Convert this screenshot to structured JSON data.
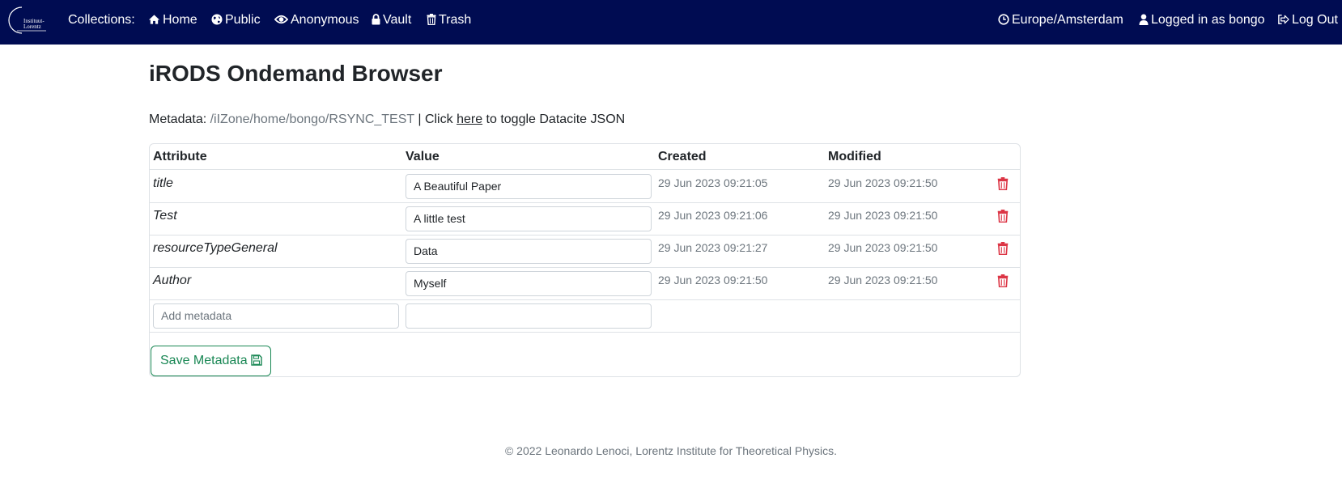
{
  "navbar": {
    "logo_text_line1": "Instituut-",
    "logo_text_line2": "Lorentz",
    "collections_label": "Collections:",
    "links": {
      "home": "Home",
      "public": "Public",
      "anonymous": "Anonymous",
      "vault": "Vault",
      "trash": "Trash"
    },
    "timezone": "Europe/Amsterdam",
    "user": "Logged in as bongo",
    "logout": "Log Out",
    "icons": {
      "home": "home-icon",
      "public": "globe-icon",
      "anonymous": "eye-icon",
      "vault": "lock-icon",
      "trash": "trash-icon",
      "timezone": "clock-icon",
      "user": "user-icon",
      "logout": "sign-out-icon"
    }
  },
  "main": {
    "title": "iRODS Ondemand Browser",
    "metadata_prefix": "Metadata:",
    "path": "/iIZone/home/bongo/RSYNC_TEST",
    "toggle_before": "| Click",
    "toggle_link": "here",
    "toggle_after": "to toggle Datacite JSON"
  },
  "table": {
    "headers": {
      "attribute": "Attribute",
      "value": "Value",
      "created": "Created",
      "modified": "Modified"
    },
    "rows": [
      {
        "attribute": "title",
        "value": "A Beautiful Paper",
        "created": "29 Jun 2023 09:21:05",
        "modified": "29 Jun 2023 09:21:50"
      },
      {
        "attribute": "Test",
        "value": "A little test",
        "created": "29 Jun 2023 09:21:06",
        "modified": "29 Jun 2023 09:21:50"
      },
      {
        "attribute": "resourceTypeGeneral",
        "value": "Data",
        "created": "29 Jun 2023 09:21:27",
        "modified": "29 Jun 2023 09:21:50"
      },
      {
        "attribute": "Author",
        "value": "Myself",
        "created": "29 Jun 2023 09:21:50",
        "modified": "29 Jun 2023 09:21:50"
      }
    ],
    "new_row": {
      "attribute_placeholder": "Add metadata",
      "value": ""
    },
    "delete_icon": "trash-icon"
  },
  "actions": {
    "save_label": "Save Metadata",
    "save_icon": "floppy-disk-icon"
  },
  "footer": {
    "text": "© 2022 Leonardo Lenoci, Lorentz Institute for Theoretical Physics."
  },
  "colors": {
    "navbar_bg": "#000c52",
    "danger": "#dc3545",
    "success": "#198754",
    "muted": "#6c757d"
  }
}
